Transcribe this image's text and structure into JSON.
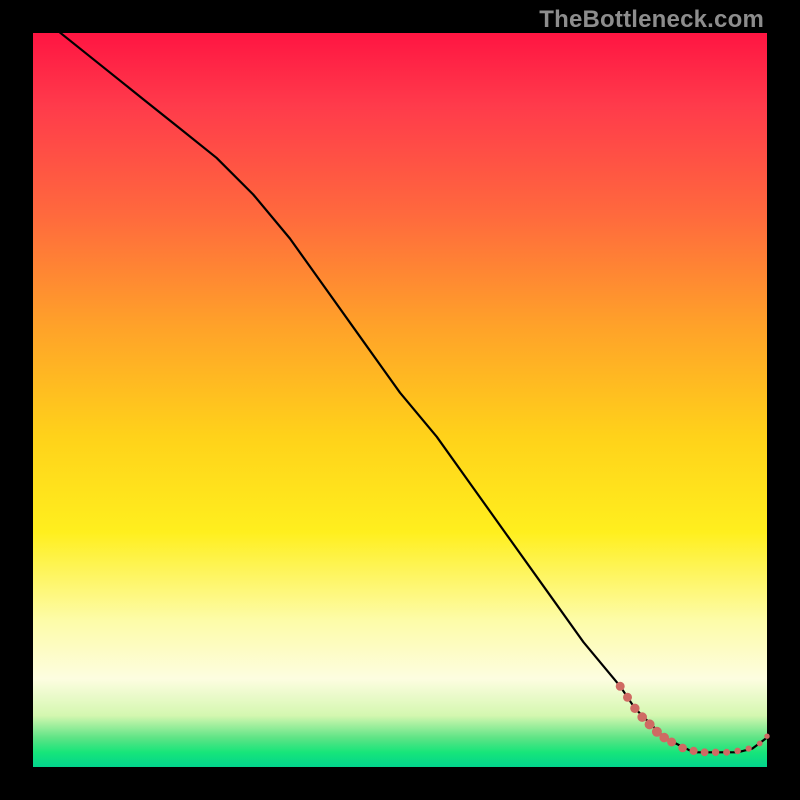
{
  "watermark": "TheBottleneck.com",
  "colors": {
    "curve": "#000000",
    "marker_fill": "#cf6a63",
    "marker_stroke": "#cf6a63"
  },
  "chart_data": {
    "type": "line",
    "title": "",
    "xlabel": "",
    "ylabel": "",
    "xlim": [
      0,
      100
    ],
    "ylim": [
      0,
      100
    ],
    "grid": false,
    "legend": false,
    "series": [
      {
        "name": "curve",
        "x": [
          0,
          5,
          10,
          15,
          20,
          25,
          30,
          35,
          40,
          45,
          50,
          55,
          60,
          65,
          70,
          75,
          80,
          82,
          84,
          86,
          88,
          90,
          92,
          94,
          96,
          98,
          100
        ],
        "y": [
          103,
          99,
          95,
          91,
          87,
          83,
          78,
          72,
          65,
          58,
          51,
          45,
          38,
          31,
          24,
          17,
          11,
          8,
          6,
          4,
          3,
          2,
          2,
          2,
          2,
          2.5,
          4
        ]
      }
    ],
    "markers": [
      {
        "x": 80.0,
        "y": 11.0,
        "r": 4.0
      },
      {
        "x": 81.0,
        "y": 9.5,
        "r": 4.0
      },
      {
        "x": 82.0,
        "y": 8.0,
        "r": 4.2
      },
      {
        "x": 83.0,
        "y": 6.8,
        "r": 4.3
      },
      {
        "x": 84.0,
        "y": 5.8,
        "r": 4.5
      },
      {
        "x": 85.0,
        "y": 4.8,
        "r": 4.5
      },
      {
        "x": 86.0,
        "y": 4.0,
        "r": 4.3
      },
      {
        "x": 87.0,
        "y": 3.4,
        "r": 4.0
      },
      {
        "x": 88.5,
        "y": 2.6,
        "r": 3.8
      },
      {
        "x": 90.0,
        "y": 2.2,
        "r": 3.6
      },
      {
        "x": 91.5,
        "y": 2.0,
        "r": 3.4
      },
      {
        "x": 93.0,
        "y": 2.0,
        "r": 3.2
      },
      {
        "x": 94.5,
        "y": 2.0,
        "r": 3.0
      },
      {
        "x": 96.0,
        "y": 2.2,
        "r": 2.8
      },
      {
        "x": 97.5,
        "y": 2.5,
        "r": 2.6
      },
      {
        "x": 99.0,
        "y": 3.2,
        "r": 2.4
      },
      {
        "x": 100.0,
        "y": 4.2,
        "r": 2.2
      }
    ]
  }
}
